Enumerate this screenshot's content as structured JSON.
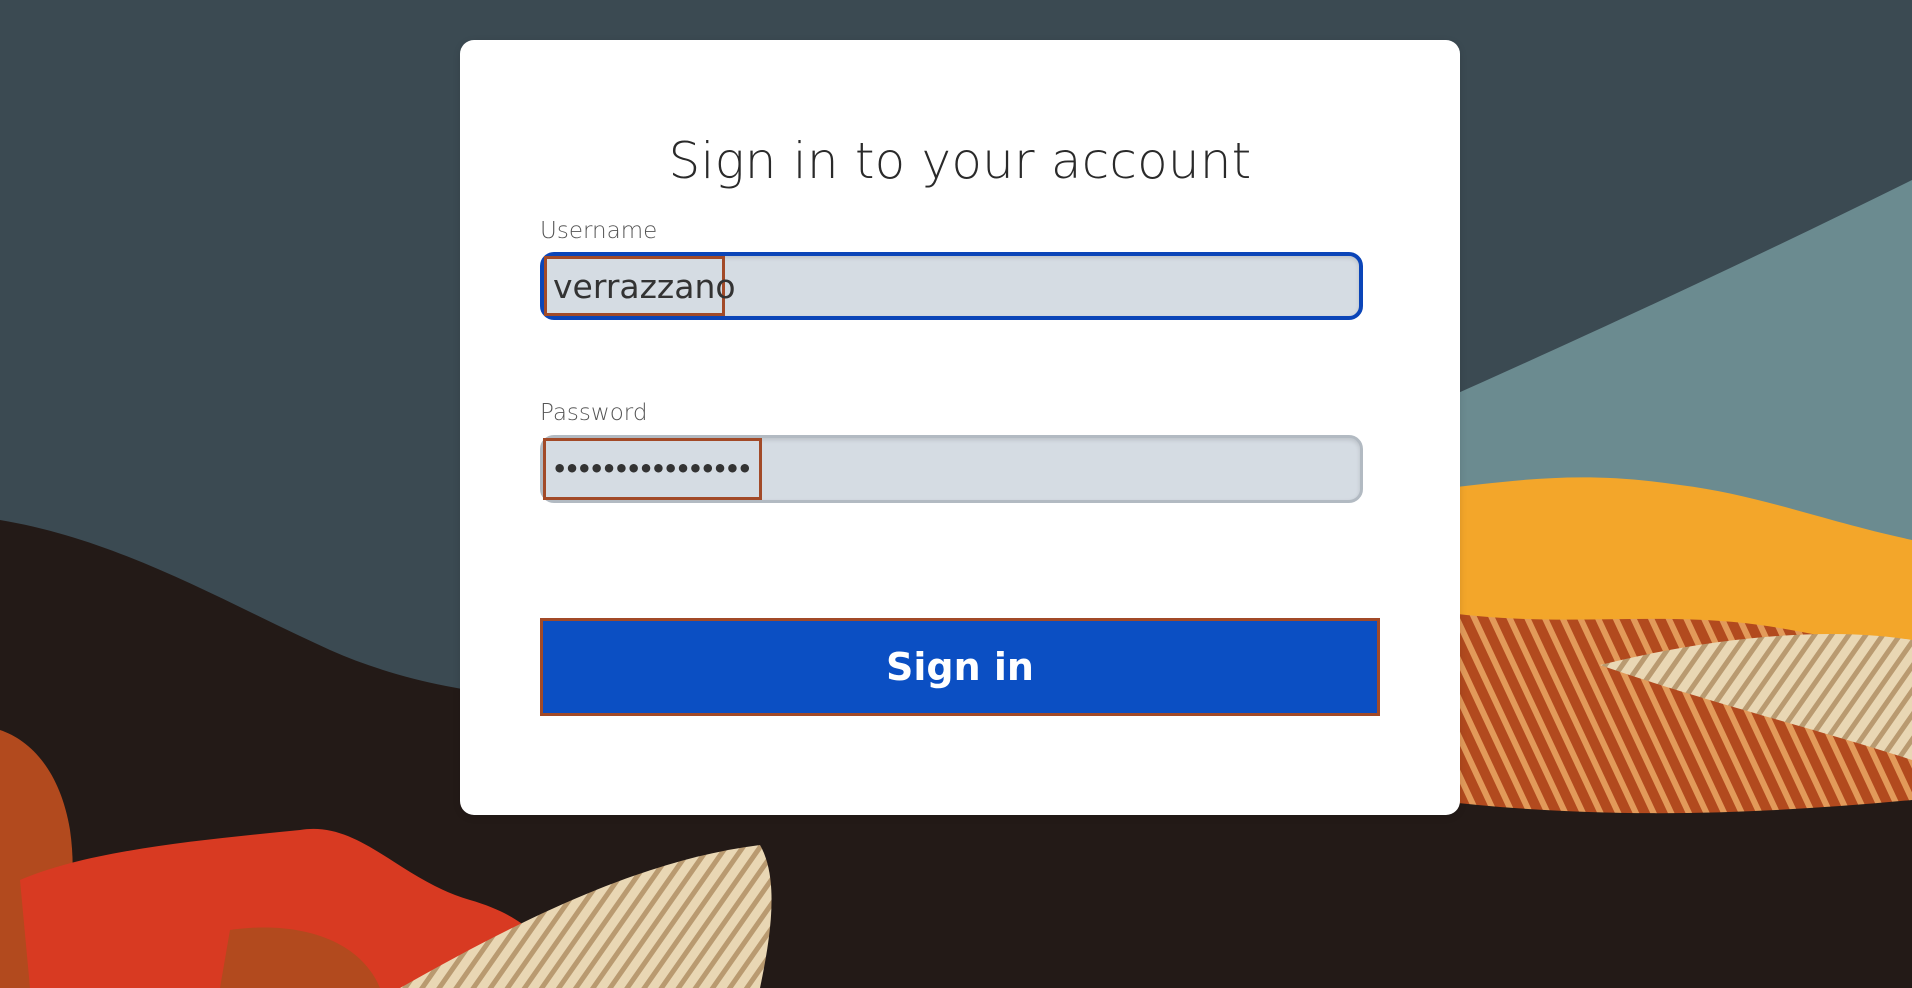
{
  "page": {
    "title": "Sign in to your account"
  },
  "form": {
    "username_label": "Username",
    "username_value": "verrazzano",
    "password_label": "Password",
    "password_value": "••••••••••••••••",
    "submit_label": "Sign in"
  },
  "colors": {
    "accent": "#0b4fc3",
    "input_bg": "#d5dce3",
    "highlight_border": "#a24a28",
    "background_dark": "#3b4a52"
  }
}
